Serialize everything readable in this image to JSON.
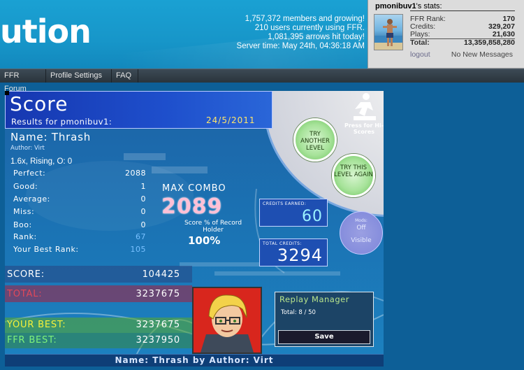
{
  "header": {
    "logo_text": "ution",
    "stats_lines": [
      "1,757,372 members and growing!",
      "210 users currently using FFR.",
      "1,081,395 arrows hit today!",
      "Server time: May 24th, 04:36:18 AM"
    ]
  },
  "user": {
    "name": "pmonibuv1",
    "stats_suffix": "'s stats:",
    "rows": [
      {
        "label": "FFR Rank:",
        "value": "170"
      },
      {
        "label": "Credits:",
        "value": "329,207"
      },
      {
        "label": "Plays:",
        "value": "21,630"
      },
      {
        "label": "Total:",
        "value": "13,359,858,280"
      }
    ],
    "logout": "logout",
    "messages": "No New Messages"
  },
  "nav": {
    "items": [
      "FFR Forum",
      "Profile Settings",
      "FAQ"
    ]
  },
  "game": {
    "score_title": "Score",
    "results_for": "Results for pmonibuv1:",
    "date": "24/5/2011",
    "song_name": "Name: Thrash",
    "song_author": "Author: Virt",
    "mods_line": "1.6x, Rising, O: 0",
    "judges": [
      {
        "label": "Perfect:",
        "value": "2088"
      },
      {
        "label": "Good:",
        "value": "1"
      },
      {
        "label": "Average:",
        "value": "0"
      },
      {
        "label": "Miss:",
        "value": "0"
      },
      {
        "label": "Boo:",
        "value": "0"
      },
      {
        "label": "Rank:",
        "value": "67"
      },
      {
        "label": "Your Best Rank:",
        "value": "105"
      }
    ],
    "max_combo_label": "MAX COMBO",
    "max_combo_value": "2089",
    "score_pct_label": "Score % of Record Holder",
    "score_pct_value": "100%",
    "credits_earned_label": "CREDITS EARNED:",
    "credits_earned_value": "60",
    "total_credits_label": "TOTAL CREDITS:",
    "total_credits_value": "3294",
    "try_another": "TRY ANOTHER LEVEL",
    "try_again": "TRY THIS LEVEL AGAIN",
    "press_hiscores": "Press for Hi-Scores",
    "mods_box": {
      "title": "Mods:",
      "line1": "Off",
      "line2": "Visible"
    },
    "score_label": "SCORE:",
    "score_value": "104425",
    "total_label": "TOTAL:",
    "total_value": "3237675",
    "your_best_label": "YOUR BEST:",
    "your_best_value": "3237675",
    "ffr_best_label": "FFR BEST:",
    "ffr_best_value": "3237950",
    "replay_title": "Replay Manager",
    "replay_total": "Total: 8 / 50",
    "save_label": "Save",
    "footer": "Name:  Thrash  by  Author:  Virt"
  },
  "colors": {
    "header_blue": "#1796c9",
    "game_blue": "#1b73b4",
    "score_red": "#c84050",
    "best_yellow": "#f6f23a",
    "ffr_best_green": "#7ef27a",
    "combo_pink": "#ffc0d6"
  }
}
